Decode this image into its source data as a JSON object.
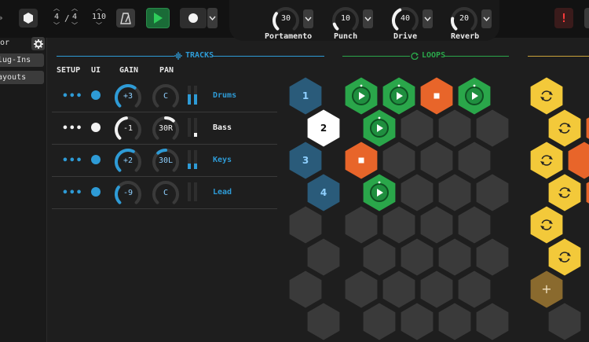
{
  "colors": {
    "accent": "#2e9bd6",
    "loops": "#2aa64a",
    "orange": "#e8652a",
    "yellow": "#f3c93a",
    "track_hex": "#2a5b7a",
    "empty_hex": "#3a3a3a"
  },
  "toolbar": {
    "time_sig_num": "4",
    "time_sig_den": "4",
    "tempo": "110",
    "icons": [
      "arrow-left-icon",
      "hexagon-icon",
      "metronome-icon",
      "play-icon",
      "record-icon",
      "chevron-down-icon",
      "alert-icon"
    ]
  },
  "macros": [
    {
      "label": "Portamento",
      "value": "30",
      "fraction": 0.3
    },
    {
      "label": "Punch",
      "value": "10",
      "fraction": 0.1
    },
    {
      "label": "Drive",
      "value": "40",
      "fraction": 0.4
    },
    {
      "label": "Reverb",
      "value": "20",
      "fraction": 0.2
    }
  ],
  "sidebar": {
    "label": "or",
    "buttons": [
      "lug-Ins",
      "ayouts"
    ]
  },
  "tracks_section": {
    "title": "TRACKS",
    "columns": {
      "setup": "SETUP",
      "ui": "UI",
      "gain": "GAIN",
      "pan": "PAN"
    },
    "rows": [
      {
        "name": "Drums",
        "gain": "+3",
        "gain_level": 0.63,
        "pan": "C",
        "pan_level": 0.0,
        "meter_l": 0.55,
        "meter_r": 0.55,
        "selected": false
      },
      {
        "name": "Bass",
        "gain": "-1",
        "gain_level": 0.47,
        "pan": "30R",
        "pan_level": 0.3,
        "meter_l": 0.0,
        "meter_r": 0.2,
        "selected": true
      },
      {
        "name": "Keys",
        "gain": "+2",
        "gain_level": 0.6,
        "pan": "30L",
        "pan_level": -0.3,
        "meter_l": 0.3,
        "meter_r": 0.3,
        "selected": false
      },
      {
        "name": "Lead",
        "gain": "-9",
        "gain_level": 0.3,
        "pan": "C",
        "pan_level": 0.0,
        "meter_l": 0.0,
        "meter_r": 0.0,
        "selected": false
      }
    ]
  },
  "loops_section": {
    "title": "LOOPS"
  },
  "track_hexes": [
    "1",
    "2",
    "3",
    "4"
  ],
  "loop_grid": [
    [
      "play",
      "play",
      "stop",
      "play"
    ],
    [
      "play",
      "empty",
      "empty",
      "empty"
    ],
    [
      "stop",
      "empty",
      "empty",
      "empty"
    ],
    [
      "play",
      "empty",
      "empty",
      "empty"
    ]
  ],
  "right_column": [
    "cycle",
    "cycle",
    "cycle",
    "cycle",
    "cycle",
    "cycle",
    "add"
  ],
  "add_label": "+"
}
